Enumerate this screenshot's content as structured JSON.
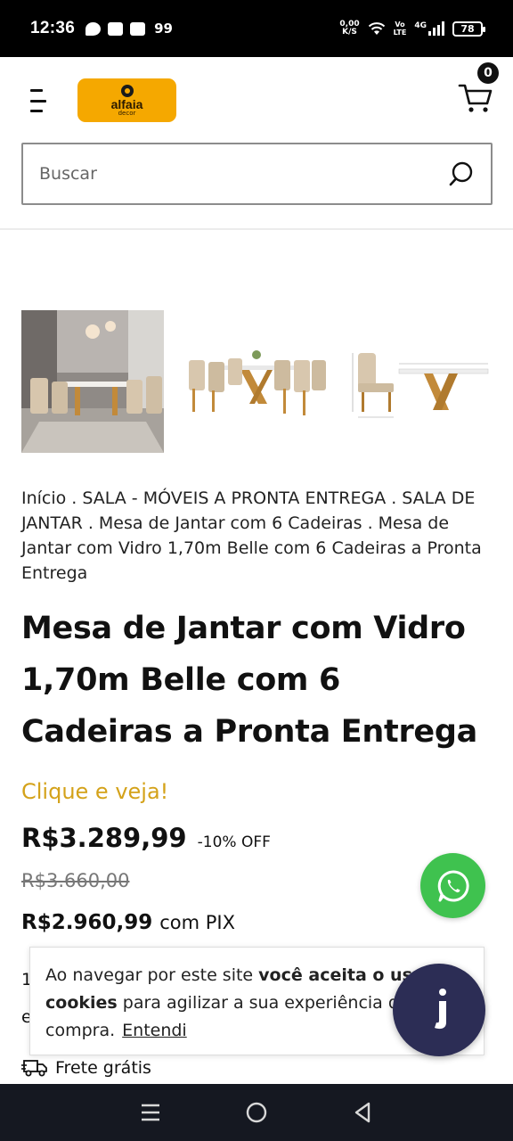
{
  "status_bar": {
    "time": "12:36",
    "notif_count": "99",
    "net_speed_value": "0,00",
    "net_speed_unit": "K/S",
    "volte_top": "Vo",
    "volte_bottom": "LTE",
    "network": "4G",
    "battery": "78"
  },
  "header": {
    "logo_name": "alfaia",
    "logo_sub": "decor",
    "cart_count": "0"
  },
  "search": {
    "placeholder": "Buscar"
  },
  "gallery": {
    "images": [
      "dining-room-photo",
      "table-with-chairs",
      "table-dimensions-drawing"
    ]
  },
  "breadcrumb": {
    "items": [
      "Início",
      "SALA - MÓVEIS A PRONTA ENTREGA",
      "SALA DE JANTAR",
      "Mesa de Jantar com 6 Cadeiras",
      "Mesa de Jantar com Vidro 1,70m Belle com 6 Cadeiras a Pronta Entrega"
    ],
    "separator": "."
  },
  "product": {
    "title": "Mesa de Jantar com Vidro 1,70m Belle com 6 Cadeiras a Pronta Entrega",
    "promo": "Clique e veja!",
    "price": "R$3.289,99",
    "discount": "-10% OFF",
    "old_price": "R$3.660,00",
    "pix_price": "R$2.960,99",
    "pix_label": "com PIX",
    "hidden_line1": "1",
    "hidden_line2": "e",
    "shipping": "Frete grátis"
  },
  "cookie": {
    "text_before": "Ao navegar por este site ",
    "bold1": "você aceita o uso de",
    "bold2": "cookies",
    "text_after": " para agilizar a sua experiência de compra.",
    "link": "Entendi"
  },
  "colors": {
    "logo": "#f5a800",
    "promo": "#d4a21a",
    "whatsapp": "#3fc24f",
    "chat": "#2c2d55",
    "navbar": "#151821"
  },
  "navbar": {
    "buttons": [
      "menu-icon",
      "home-icon",
      "back-icon"
    ]
  }
}
